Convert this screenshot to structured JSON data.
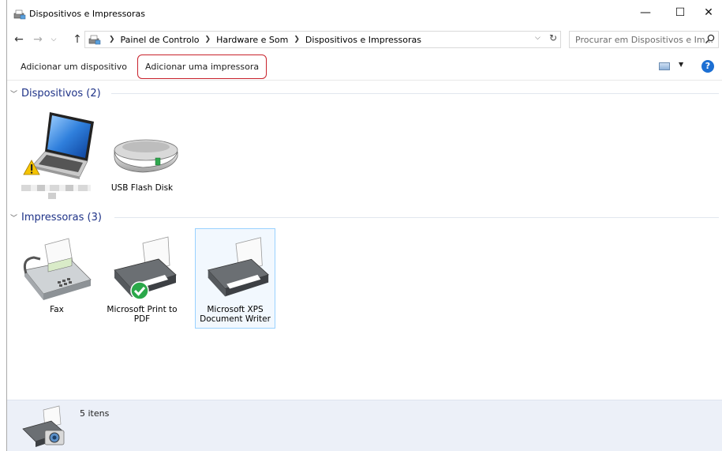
{
  "window": {
    "title": "Dispositivos e Impressoras",
    "controls": {
      "minimize": "—",
      "maximize": "☐",
      "close": "✕"
    }
  },
  "address": {
    "crumbs": [
      "Painel de Controlo",
      "Hardware e Som",
      "Dispositivos e Impressoras"
    ],
    "search_placeholder": "Procurar em Dispositivos e Im..."
  },
  "commands": {
    "add_device": "Adicionar um dispositivo",
    "add_printer": "Adicionar uma impressora",
    "highlight_color": "#c8222c"
  },
  "groups": {
    "devices": {
      "title": "Dispositivos (2)",
      "items": [
        {
          "name": "",
          "icon": "laptop-warning-icon"
        },
        {
          "name": "USB Flash Disk",
          "icon": "usb-drive-icon"
        }
      ]
    },
    "printers": {
      "title": "Impressoras (3)",
      "items": [
        {
          "name": "Fax",
          "icon": "fax-icon"
        },
        {
          "name": "Microsoft Print to PDF",
          "icon": "printer-default-icon",
          "default": true
        },
        {
          "name": "Microsoft XPS Document Writer",
          "icon": "printer-icon",
          "selected": true
        }
      ]
    }
  },
  "status": {
    "count": "5 itens"
  }
}
